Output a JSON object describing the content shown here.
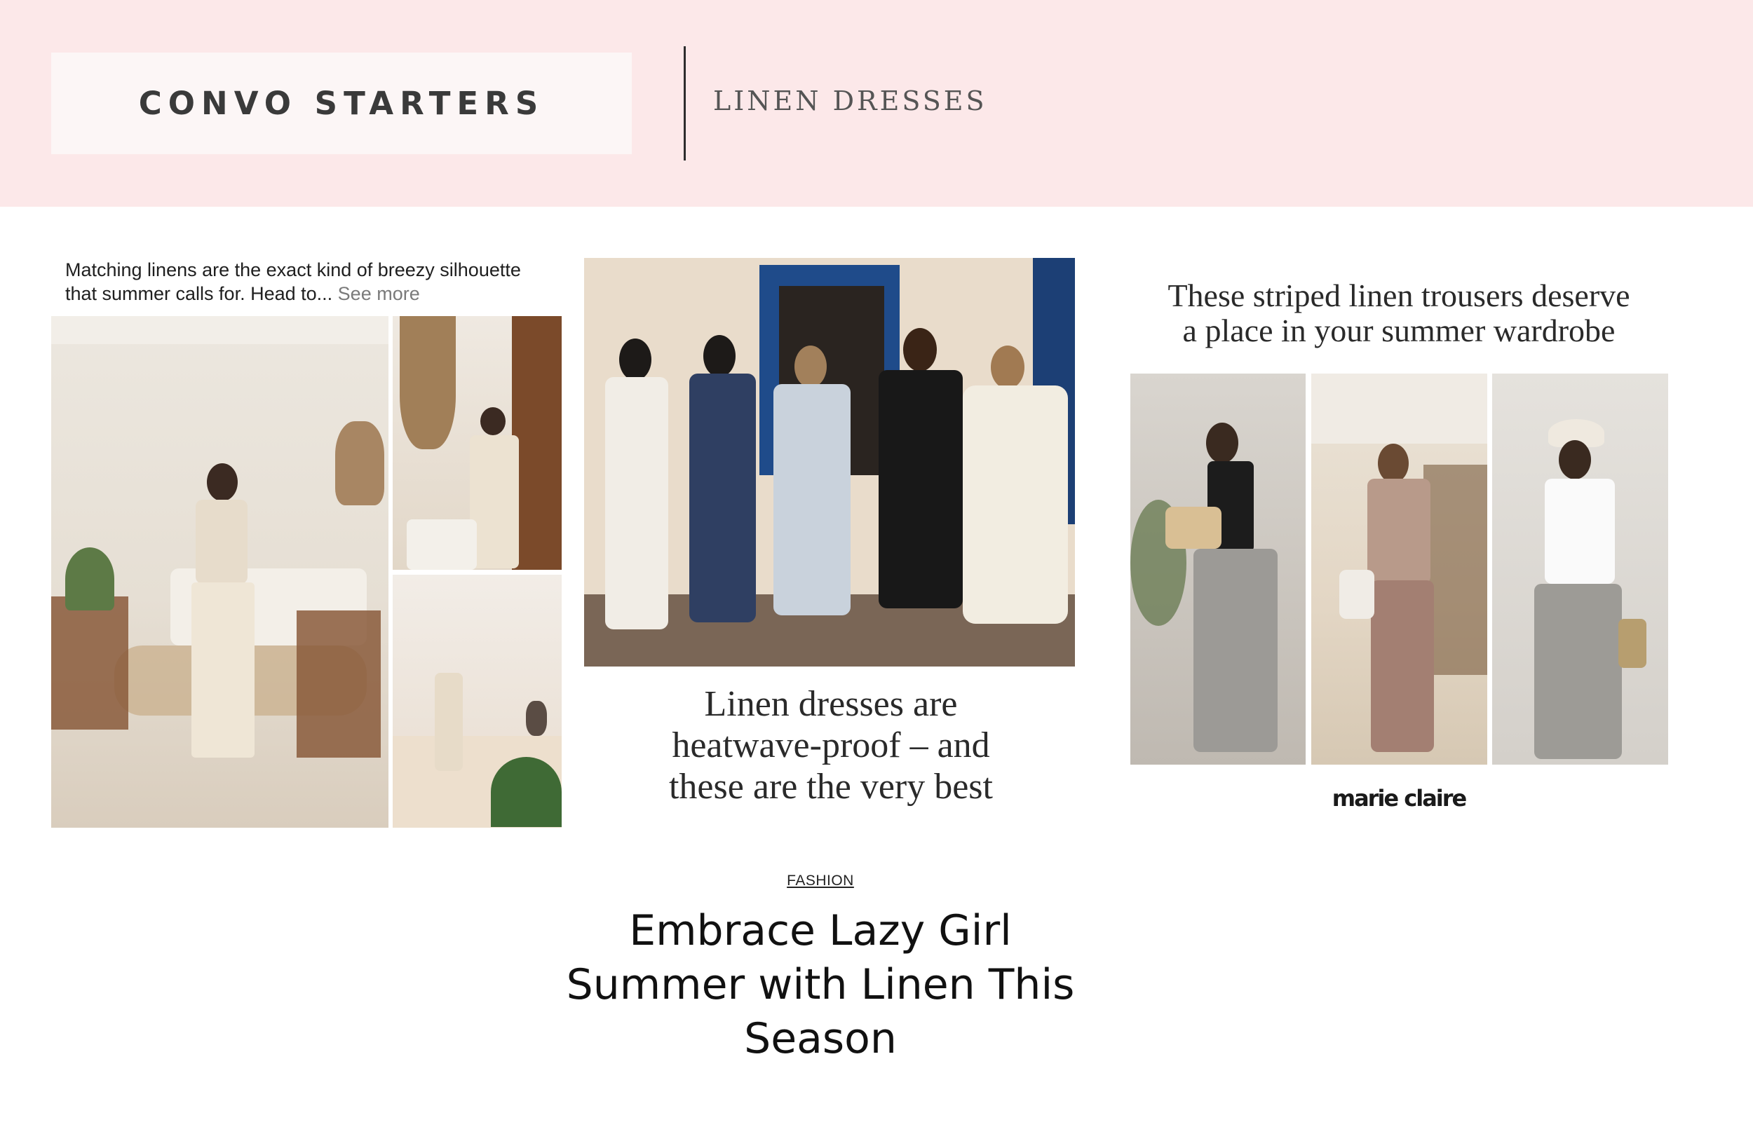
{
  "header": {
    "brand": "CONVO STARTERS",
    "topic": "LINEN DRESSES"
  },
  "card_social": {
    "caption": "Matching linens are the exact kind of breezy silhouette that summer calls for. Head to...",
    "see_more": "See more"
  },
  "card_dresses": {
    "headline_lines": [
      "Linen dresses are",
      "heatwave-proof – and",
      "these are the very best"
    ]
  },
  "card_trousers": {
    "headline_lines": [
      "These striped linen trousers deserve",
      "a place in your summer wardrobe"
    ],
    "logo": "marie claire"
  },
  "article": {
    "tag": "FASHION",
    "title_lines": [
      "Embrace Lazy Girl",
      "Summer with Linen This",
      "Season"
    ]
  },
  "colors": {
    "header_bg": "#fce8e9",
    "brand_box_bg": "#fcf6f6",
    "text_dark": "#111111"
  }
}
